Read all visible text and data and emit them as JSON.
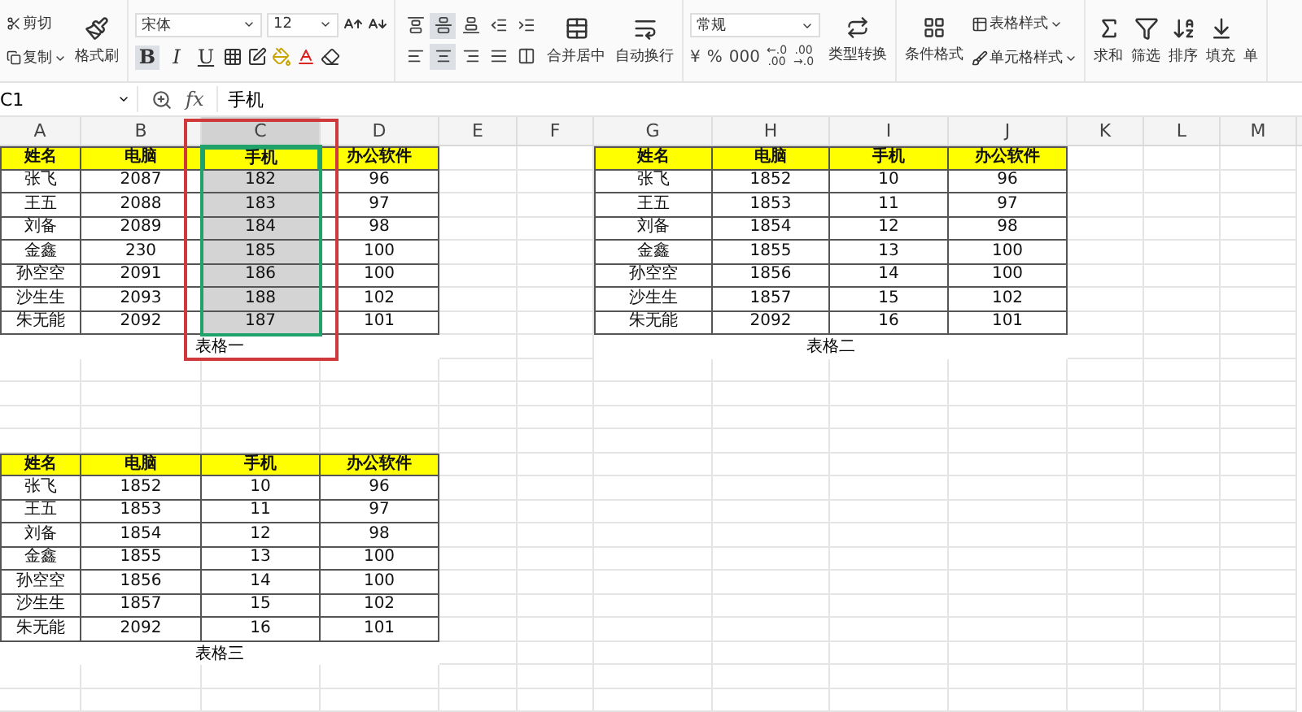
{
  "ribbon": {
    "clipboard": {
      "cut": "剪切",
      "copy": "复制",
      "painter": "格式刷"
    },
    "font": {
      "family": "宋体",
      "size": "12",
      "styles": [
        {
          "kind": "bold",
          "label": "B",
          "selected": true
        },
        {
          "kind": "italic",
          "label": "I",
          "selected": false
        },
        {
          "kind": "underline",
          "label": "U",
          "selected": false
        }
      ]
    },
    "alignment": [
      {
        "kind": "top",
        "selected": false
      },
      {
        "kind": "middle",
        "selected": true
      },
      {
        "kind": "bottom",
        "selected": false
      },
      {
        "kind": "outdent",
        "selected": false
      },
      {
        "kind": "indent",
        "selected": false
      },
      {
        "kind": "left",
        "selected": false
      },
      {
        "kind": "center",
        "selected": true
      },
      {
        "kind": "right",
        "selected": false
      },
      {
        "kind": "justify",
        "selected": false
      },
      {
        "kind": "distributed",
        "selected": false
      }
    ],
    "merge": "合并居中",
    "wrap": "自动换行",
    "number": {
      "format": "常规",
      "symbols": [
        "¥",
        "%",
        "000"
      ],
      "decimals": [
        {
          "top": "←.0",
          "bottom": ".00"
        },
        {
          "top": ".00",
          "bottom": "→.0"
        }
      ],
      "convert": "类型转换"
    },
    "styles": {
      "conditional": "条件格式",
      "table": "表格样式",
      "cell": "单元格样式"
    },
    "editing": [
      {
        "kind": "sum",
        "label": "求和"
      },
      {
        "kind": "filter",
        "label": "筛选"
      },
      {
        "kind": "sort",
        "label": "排序"
      },
      {
        "kind": "fill",
        "label": "填充"
      },
      {
        "kind": "cutoff",
        "label": "单"
      }
    ]
  },
  "formula_bar": {
    "cell": "C1",
    "function_label": "fx",
    "formula": "手机"
  },
  "columns": [
    {
      "label": "A",
      "selected": false,
      "annotated": false
    },
    {
      "label": "B",
      "selected": false,
      "annotated": false
    },
    {
      "label": "C",
      "selected": true,
      "annotated": true
    },
    {
      "label": "D",
      "selected": false,
      "annotated": false
    },
    {
      "label": "E",
      "selected": false,
      "annotated": false
    },
    {
      "label": "F",
      "selected": false,
      "annotated": false
    },
    {
      "label": "G",
      "selected": false,
      "annotated": false
    },
    {
      "label": "H",
      "selected": false,
      "annotated": false
    },
    {
      "label": "I",
      "selected": false,
      "annotated": false
    },
    {
      "label": "J",
      "selected": false,
      "annotated": false
    },
    {
      "label": "K",
      "selected": false,
      "annotated": false
    },
    {
      "label": "L",
      "selected": false,
      "annotated": false
    },
    {
      "label": "M",
      "selected": false,
      "annotated": false
    }
  ],
  "tables": [
    {
      "caption": "表格一",
      "headers": [
        {
          "label": "姓名",
          "selected": false
        },
        {
          "label": "电脑",
          "selected": false
        },
        {
          "label": "手机",
          "selected": true
        },
        {
          "label": "办公软件",
          "selected": false
        }
      ],
      "rows": [
        [
          "张飞",
          "2087",
          "182",
          "96"
        ],
        [
          "王五",
          "2088",
          "183",
          "97"
        ],
        [
          "刘备",
          "2089",
          "184",
          "98"
        ],
        [
          "金鑫",
          "230",
          "185",
          "100"
        ],
        [
          "孙空空",
          "2091",
          "186",
          "100"
        ],
        [
          "沙生生",
          "2093",
          "188",
          "102"
        ],
        [
          "朱无能",
          "2092",
          "187",
          "101"
        ]
      ]
    },
    {
      "caption": "表格二",
      "headers": [
        {
          "label": "姓名",
          "selected": false
        },
        {
          "label": "电脑",
          "selected": false
        },
        {
          "label": "手机",
          "selected": false
        },
        {
          "label": "办公软件",
          "selected": false
        }
      ],
      "rows": [
        [
          "张飞",
          "1852",
          "10",
          "96"
        ],
        [
          "王五",
          "1853",
          "11",
          "97"
        ],
        [
          "刘备",
          "1854",
          "12",
          "98"
        ],
        [
          "金鑫",
          "1855",
          "13",
          "100"
        ],
        [
          "孙空空",
          "1856",
          "14",
          "100"
        ],
        [
          "沙生生",
          "1857",
          "15",
          "102"
        ],
        [
          "朱无能",
          "2092",
          "16",
          "101"
        ]
      ]
    },
    {
      "caption": "表格三",
      "headers": [
        {
          "label": "姓名",
          "selected": false
        },
        {
          "label": "电脑",
          "selected": false
        },
        {
          "label": "手机",
          "selected": false
        },
        {
          "label": "办公软件",
          "selected": false
        }
      ],
      "rows": [
        [
          "张飞",
          "1852",
          "10",
          "96"
        ],
        [
          "王五",
          "1853",
          "11",
          "97"
        ],
        [
          "刘备",
          "1854",
          "12",
          "98"
        ],
        [
          "金鑫",
          "1855",
          "13",
          "100"
        ],
        [
          "孙空空",
          "1856",
          "14",
          "100"
        ],
        [
          "沙生生",
          "1857",
          "15",
          "102"
        ],
        [
          "朱无能",
          "2092",
          "16",
          "101"
        ]
      ]
    }
  ]
}
